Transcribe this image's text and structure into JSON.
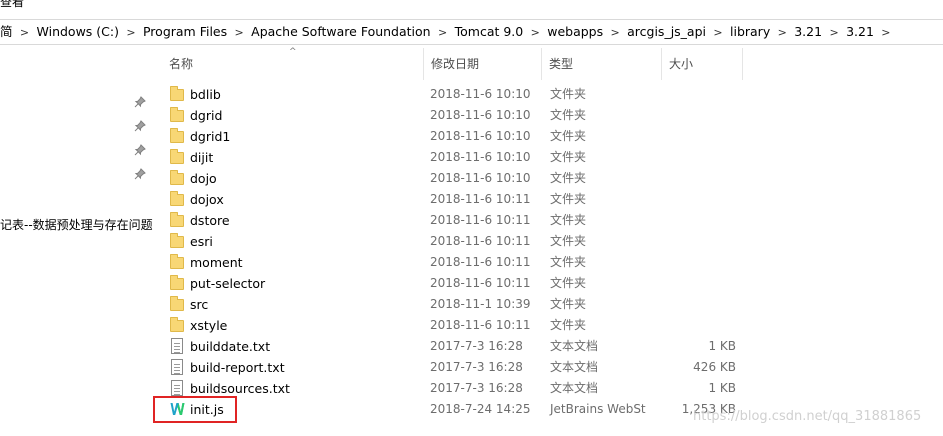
{
  "window": {
    "title_fragment": "查看"
  },
  "address_bar": {
    "crumbs": [
      {
        "label": "简"
      },
      {
        "label": "Windows (C:)"
      },
      {
        "label": "Program Files"
      },
      {
        "label": "Apache Software Foundation"
      },
      {
        "label": "Tomcat 9.0"
      },
      {
        "label": "webapps"
      },
      {
        "label": "arcgis_js_api"
      },
      {
        "label": "library"
      },
      {
        "label": "3.21"
      },
      {
        "label": "3.21"
      }
    ],
    "separator": ">"
  },
  "nav_pane": {
    "pin_icon": "pin-icon",
    "partial_item": "记表--数据预处理与存在问题"
  },
  "columns": {
    "name": "名称",
    "date_modified": "修改日期",
    "type": "类型",
    "size": "大小"
  },
  "files": [
    {
      "name": "bdlib",
      "date": "2018-11-6 10:10",
      "type": "文件夹",
      "size": "",
      "icon": "folder-icon"
    },
    {
      "name": "dgrid",
      "date": "2018-11-6 10:10",
      "type": "文件夹",
      "size": "",
      "icon": "folder-icon"
    },
    {
      "name": "dgrid1",
      "date": "2018-11-6 10:10",
      "type": "文件夹",
      "size": "",
      "icon": "folder-icon"
    },
    {
      "name": "dijit",
      "date": "2018-11-6 10:10",
      "type": "文件夹",
      "size": "",
      "icon": "folder-icon"
    },
    {
      "name": "dojo",
      "date": "2018-11-6 10:10",
      "type": "文件夹",
      "size": "",
      "icon": "folder-icon"
    },
    {
      "name": "dojox",
      "date": "2018-11-6 10:11",
      "type": "文件夹",
      "size": "",
      "icon": "folder-icon"
    },
    {
      "name": "dstore",
      "date": "2018-11-6 10:11",
      "type": "文件夹",
      "size": "",
      "icon": "folder-icon"
    },
    {
      "name": "esri",
      "date": "2018-11-6 10:11",
      "type": "文件夹",
      "size": "",
      "icon": "folder-icon"
    },
    {
      "name": "moment",
      "date": "2018-11-6 10:11",
      "type": "文件夹",
      "size": "",
      "icon": "folder-icon"
    },
    {
      "name": "put-selector",
      "date": "2018-11-6 10:11",
      "type": "文件夹",
      "size": "",
      "icon": "folder-icon"
    },
    {
      "name": "src",
      "date": "2018-11-1 10:39",
      "type": "文件夹",
      "size": "",
      "icon": "folder-icon"
    },
    {
      "name": "xstyle",
      "date": "2018-11-6 10:11",
      "type": "文件夹",
      "size": "",
      "icon": "folder-icon"
    },
    {
      "name": "builddate.txt",
      "date": "2017-7-3 16:28",
      "type": "文本文档",
      "size": "1 KB",
      "icon": "text-file-icon"
    },
    {
      "name": "build-report.txt",
      "date": "2017-7-3 16:28",
      "type": "文本文档",
      "size": "426 KB",
      "icon": "text-file-icon"
    },
    {
      "name": "buildsources.txt",
      "date": "2017-7-3 16:28",
      "type": "文本文档",
      "size": "1 KB",
      "icon": "text-file-icon"
    },
    {
      "name": "init.js",
      "date": "2018-7-24 14:25",
      "type": "JetBrains WebSt",
      "size": "1,253 KB",
      "icon": "webstorm-file-icon"
    }
  ],
  "annotation": {
    "highlight_color": "#e02424",
    "highlighted_item": "init.js"
  },
  "watermark": "https://blog.csdn.net/qq_31881865",
  "colors": {
    "folder": "#f8d775",
    "meta_text": "#6d6d6d",
    "header_text": "#4d4d4d"
  }
}
